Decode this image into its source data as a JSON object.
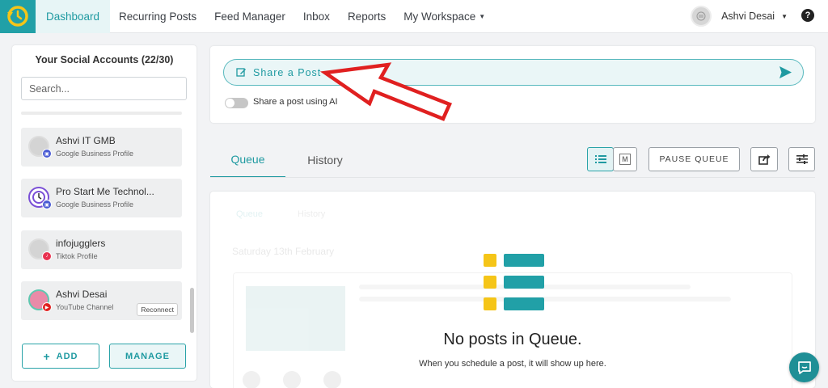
{
  "colors": {
    "accent": "#1f9aa1",
    "annotation_arrow": "#e02020",
    "queue_icon_yellow": "#f5c518",
    "queue_icon_teal": "#21a0a7"
  },
  "nav": {
    "items": [
      {
        "label": "Dashboard",
        "active": true
      },
      {
        "label": "Recurring Posts"
      },
      {
        "label": "Feed Manager"
      },
      {
        "label": "Inbox"
      },
      {
        "label": "Reports"
      },
      {
        "label": "My Workspace"
      }
    ],
    "user_name": "Ashvi Desai",
    "help_icon": "question-circle-icon"
  },
  "sidebar": {
    "title": "Your Social Accounts (22/30)",
    "search_placeholder": "Search...",
    "accounts": [
      {
        "name": "Ashvi IT GMB",
        "type": "Google Business Profile",
        "badge_icon": "google-business-icon"
      },
      {
        "name": "Pro Start Me Technol...",
        "type": "Google Business Profile",
        "badge_icon": "google-business-icon"
      },
      {
        "name": "infojugglers",
        "type": "Tiktok Profile",
        "badge_icon": "tiktok-icon"
      },
      {
        "name": "Ashvi Desai",
        "type": "YouTube Channel",
        "badge_icon": "youtube-icon",
        "action": "Reconnect"
      }
    ],
    "add_label": "ADD",
    "manage_label": "MANAGE"
  },
  "share": {
    "label": "Share a Post",
    "ai_toggle_label": "Share a post using AI",
    "ai_toggle_on": false
  },
  "tabs": {
    "queue": "Queue",
    "history": "History"
  },
  "toolbar": {
    "pause_label": "PAUSE QUEUE",
    "calendar_mark": "M"
  },
  "queue": {
    "background_preview": {
      "tabs": [
        "Queue",
        "History"
      ],
      "date": "Saturday 13th February"
    },
    "empty_title": "No posts in Queue.",
    "empty_subtitle": "When you schedule a post, it will show up here."
  }
}
